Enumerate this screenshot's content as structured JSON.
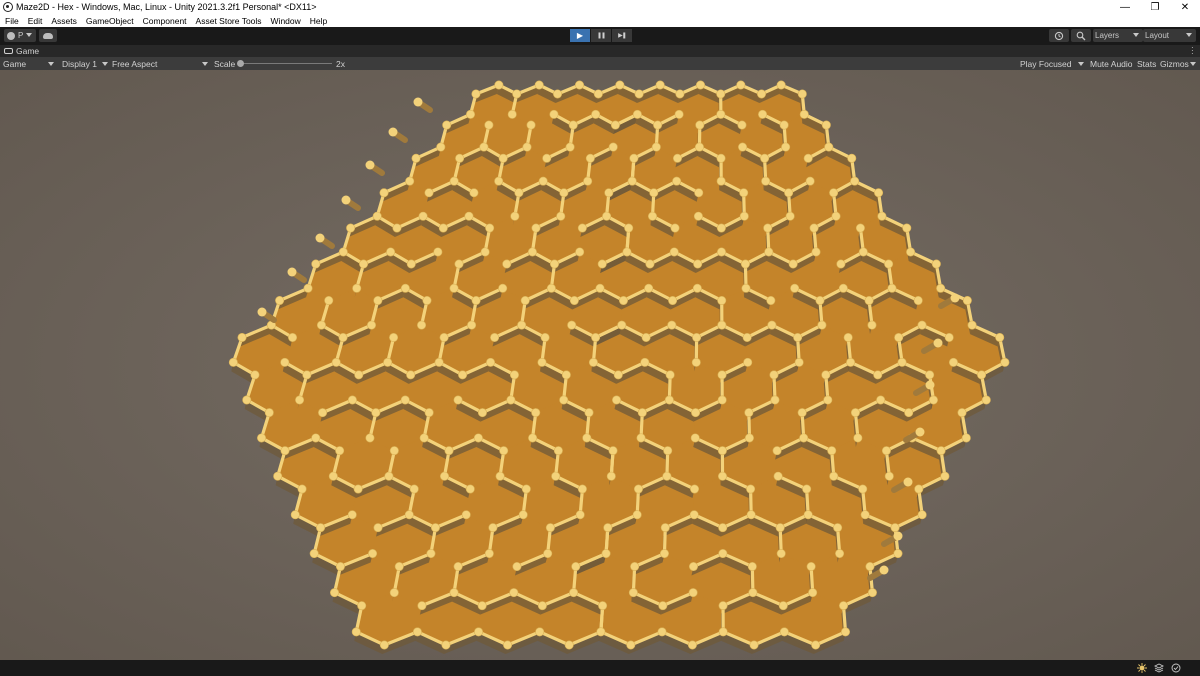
{
  "window": {
    "title": "Maze2D - Hex - Windows, Mac, Linux - Unity 2021.3.2f1 Personal* <DX11>",
    "minimize_glyph": "—",
    "maximize_glyph": "❐",
    "close_glyph": "✕"
  },
  "menu": [
    "File",
    "Edit",
    "Assets",
    "GameObject",
    "Component",
    "Asset Store Tools",
    "Window",
    "Help"
  ],
  "toolbar": {
    "account_label": "P",
    "play_glyph": "▶",
    "pause_glyph": "❚❚",
    "step_glyph": "▶❚",
    "play_active": true,
    "layers_label": "Layers",
    "layout_label": "Layout",
    "accent_color": "#3a72b0"
  },
  "tabs": {
    "game_tab_label": "Game"
  },
  "game_view": {
    "mode_label": "Game",
    "display_label": "Display 1",
    "aspect_label": "Free Aspect",
    "scale_label": "Scale",
    "scale_value": "2x",
    "play_focused_label": "Play Focused",
    "mute_audio_label": "Mute Audio",
    "stats_label": "Stats",
    "gizmos_label": "Gizmos"
  },
  "scene": {
    "description_colors": {
      "floor": "#c4842a",
      "wall": "#f3d27a",
      "wall_shadow": "#6f5a3a",
      "background": "#6b625a"
    }
  },
  "status_icons": [
    "light-icon",
    "layers-stack-icon",
    "cache-status-icon"
  ]
}
